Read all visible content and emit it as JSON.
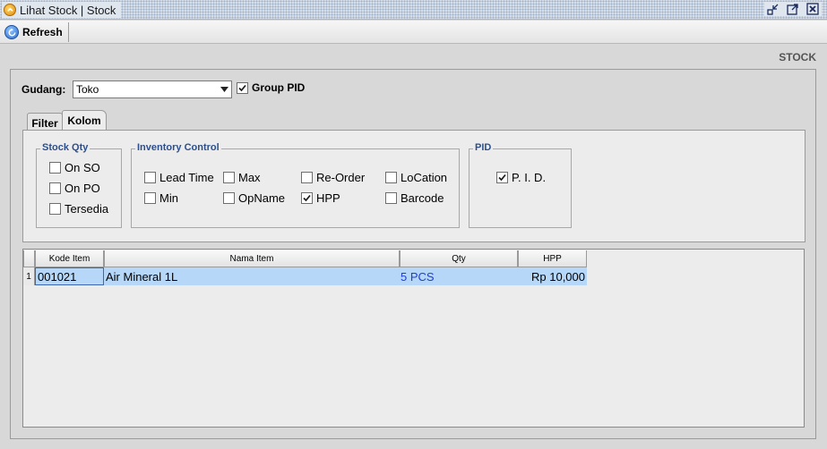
{
  "window": {
    "title": "Lihat Stock | Stock",
    "icons": [
      "app-icon",
      "minimize-icon",
      "maximize-icon",
      "close-icon"
    ]
  },
  "toolbar": {
    "refresh_label": "Refresh",
    "refresh_icon": "refresh-icon"
  },
  "page_label": "STOCK",
  "gudang": {
    "label": "Gudang:",
    "value": "Toko"
  },
  "group_pid": {
    "label": "Group PID",
    "checked": true
  },
  "tabs": [
    {
      "label": "Filter",
      "active": false
    },
    {
      "label": "Kolom",
      "active": true
    }
  ],
  "stock_qty": {
    "legend": "Stock Qty",
    "items": [
      {
        "label": "On SO",
        "checked": false
      },
      {
        "label": "On PO",
        "checked": false
      },
      {
        "label": "Tersedia",
        "checked": false
      }
    ]
  },
  "inventory_control": {
    "legend": "Inventory Control",
    "items": [
      {
        "label": "Lead Time",
        "checked": false
      },
      {
        "label": "Max",
        "checked": false
      },
      {
        "label": "Re-Order",
        "checked": false
      },
      {
        "label": "LoCation",
        "checked": false
      },
      {
        "label": "Min",
        "checked": false
      },
      {
        "label": "OpName",
        "checked": false
      },
      {
        "label": "HPP",
        "checked": true
      },
      {
        "label": "Barcode",
        "checked": false
      }
    ]
  },
  "pid_group": {
    "legend": "PID",
    "items": [
      {
        "label": "P. I. D.",
        "checked": true
      }
    ]
  },
  "grid": {
    "columns": [
      "Kode Item",
      "Nama Item",
      "Qty",
      "HPP"
    ],
    "rows": [
      {
        "num": "1",
        "kode": "001021",
        "nama": "Air Mineral 1L",
        "qty": "5 PCS",
        "hpp": "Rp 10,000"
      }
    ],
    "colors": {
      "selected_row": "#b6d7f7",
      "qty_text": "#1f3fd0"
    }
  }
}
